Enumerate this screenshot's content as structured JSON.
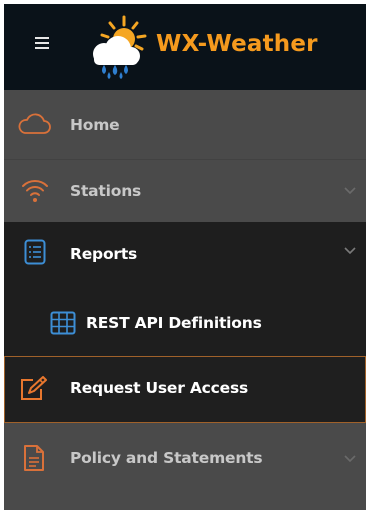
{
  "header": {
    "menu_toggle_icon": "hamburger-icon",
    "logo_icon": "sun-cloud-rain-icon",
    "app_title": "WX-Weather",
    "title_color": "#f59a1e"
  },
  "menu": {
    "items": [
      {
        "label": "Home",
        "icon": "cloud-icon",
        "expandable": false,
        "state": "default"
      },
      {
        "label": "Stations",
        "icon": "wifi-icon",
        "expandable": true,
        "state": "collapsed"
      },
      {
        "label": "Reports",
        "icon": "list-document-icon",
        "expandable": true,
        "state": "expanded",
        "children": [
          {
            "label": "REST API Definitions",
            "icon": "grid-table-icon"
          }
        ]
      },
      {
        "label": "Request User Access",
        "icon": "edit-pencil-icon",
        "expandable": false,
        "state": "focused"
      },
      {
        "label": "Policy and Statements",
        "icon": "document-icon",
        "expandable": true,
        "state": "collapsed"
      }
    ]
  },
  "colors": {
    "header_bg": "#0a1219",
    "sidebar_bg": "#4a4a4a",
    "active_bg": "#1e1e1e",
    "accent_orange": "#e8772e",
    "accent_blue": "#3d8fd6",
    "focus_border": "#a0612a"
  }
}
